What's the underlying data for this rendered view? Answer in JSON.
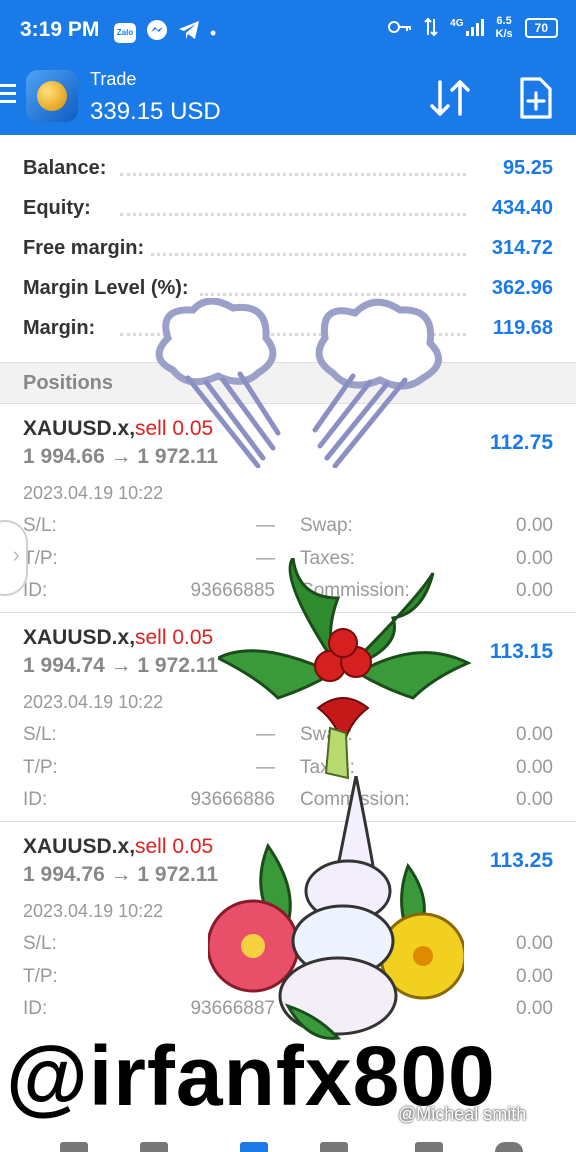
{
  "status_bar": {
    "time": "3:19 PM",
    "app_icons": [
      "Zalo",
      "messenger-icon",
      "telegram-icon"
    ],
    "network": "4G",
    "speed": [
      "6.5",
      "K/s"
    ],
    "battery": "70"
  },
  "header": {
    "title": "Trade",
    "subtitle": "339.15 USD",
    "accent_color": "#1a7ae8"
  },
  "summary": [
    {
      "label": "Balance:",
      "value": "95.25"
    },
    {
      "label": "Equity:",
      "value": "434.40"
    },
    {
      "label": "Free margin:",
      "value": "314.72"
    },
    {
      "label": "Margin Level (%):",
      "value": "362.96"
    },
    {
      "label": "Margin:",
      "value": "119.68"
    }
  ],
  "positions_header": "Positions",
  "positions": [
    {
      "symbol": "XAUUSD.x,",
      "type": "sell 0.05",
      "prices": "1 994.66 → 1 972.11",
      "profit": "112.75",
      "time": "2023.04.19 10:22",
      "sl_label": "S/L:",
      "sl": "—",
      "tp_label": "T/P:",
      "tp": "—",
      "id_label": "ID:",
      "id": "93666885",
      "swap_label": "Swap:",
      "swap": "0.00",
      "taxes_label": "Taxes:",
      "taxes": "0.00",
      "commission_label": "Commission:",
      "commission": "0.00"
    },
    {
      "symbol": "XAUUSD.x,",
      "type": "sell 0.05",
      "prices": "1 994.74 → 1 972.11",
      "profit": "113.15",
      "time": "2023.04.19 10:22",
      "sl_label": "S/L:",
      "sl": "—",
      "tp_label": "T/P:",
      "tp": "—",
      "id_label": "ID:",
      "id": "93666886",
      "swap_label": "Swap:",
      "swap": "0.00",
      "taxes_label": "Taxes:",
      "taxes": "0.00",
      "commission_label": "Commission:",
      "commission": "0.00"
    },
    {
      "symbol": "XAUUSD.x,",
      "type": "sell 0.05",
      "prices": "1 994.76 → 1 972.11",
      "profit": "113.25",
      "time": "2023.04.19 10:22",
      "sl_label": "S/L:",
      "sl": "",
      "tp_label": "T/P:",
      "tp": "",
      "id_label": "ID:",
      "id": "93666887",
      "swap_label": "",
      "swap": "0.00",
      "taxes_label": "",
      "taxes": "0.00",
      "commission_label": "",
      "commission": "0.00"
    }
  ],
  "overlay": {
    "watermark": "@irfanfx800",
    "credit": "@Micheal smith"
  }
}
